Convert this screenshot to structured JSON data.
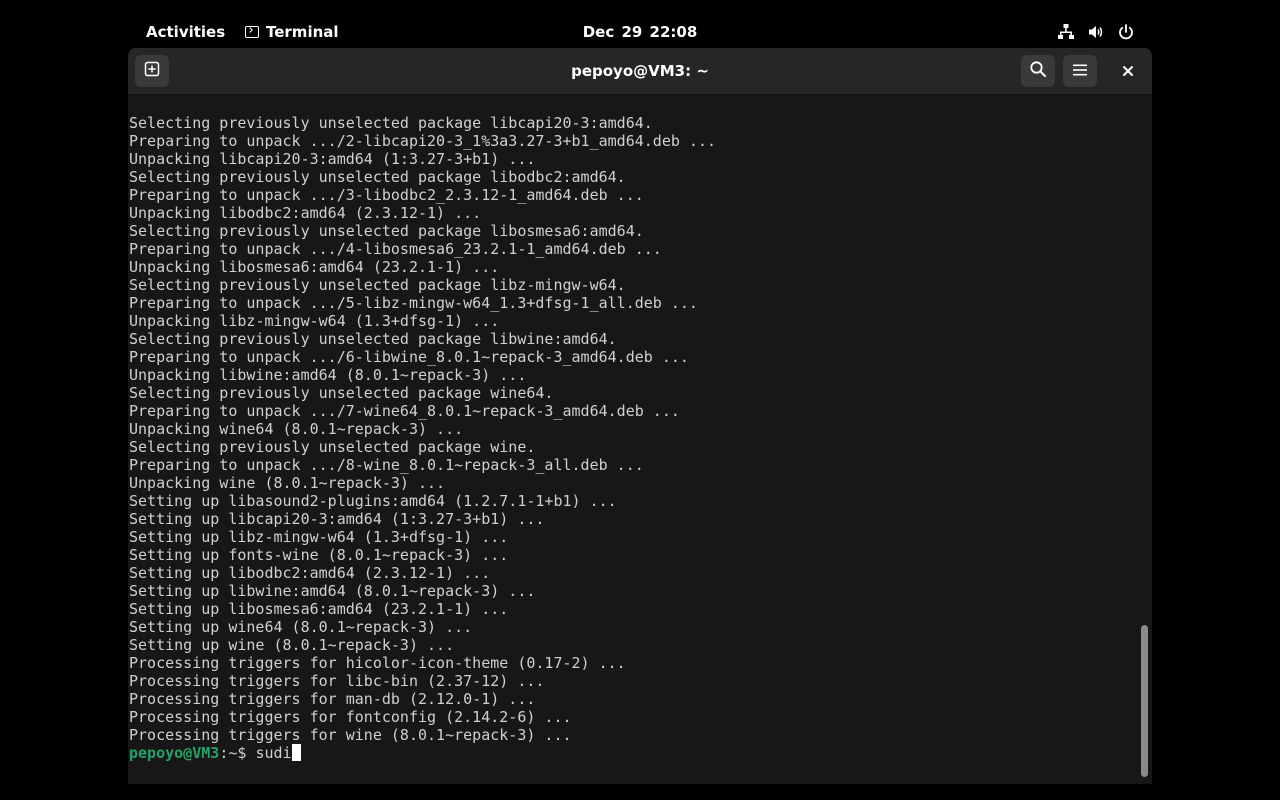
{
  "topbar": {
    "activities_label": "Activities",
    "app_name": "Terminal",
    "app_icon": "terminal-icon",
    "clock": "Dec 29  22:08",
    "tray_icons": [
      "network-icon",
      "volume-icon",
      "power-icon"
    ]
  },
  "window": {
    "title": "pepoyo@VM3: ~",
    "new_tab_icon": "new-tab-icon",
    "search_icon": "search-icon",
    "menu_icon": "hamburger-menu-icon",
    "close_icon": "close-icon"
  },
  "terminal": {
    "lines": [
      "Selecting previously unselected package libcapi20-3:amd64.",
      "Preparing to unpack .../2-libcapi20-3_1%3a3.27-3+b1_amd64.deb ...",
      "Unpacking libcapi20-3:amd64 (1:3.27-3+b1) ...",
      "Selecting previously unselected package libodbc2:amd64.",
      "Preparing to unpack .../3-libodbc2_2.3.12-1_amd64.deb ...",
      "Unpacking libodbc2:amd64 (2.3.12-1) ...",
      "Selecting previously unselected package libosmesa6:amd64.",
      "Preparing to unpack .../4-libosmesa6_23.2.1-1_amd64.deb ...",
      "Unpacking libosmesa6:amd64 (23.2.1-1) ...",
      "Selecting previously unselected package libz-mingw-w64.",
      "Preparing to unpack .../5-libz-mingw-w64_1.3+dfsg-1_all.deb ...",
      "Unpacking libz-mingw-w64 (1.3+dfsg-1) ...",
      "Selecting previously unselected package libwine:amd64.",
      "Preparing to unpack .../6-libwine_8.0.1~repack-3_amd64.deb ...",
      "Unpacking libwine:amd64 (8.0.1~repack-3) ...",
      "Selecting previously unselected package wine64.",
      "Preparing to unpack .../7-wine64_8.0.1~repack-3_amd64.deb ...",
      "Unpacking wine64 (8.0.1~repack-3) ...",
      "Selecting previously unselected package wine.",
      "Preparing to unpack .../8-wine_8.0.1~repack-3_all.deb ...",
      "Unpacking wine (8.0.1~repack-3) ...",
      "Setting up libasound2-plugins:amd64 (1.2.7.1-1+b1) ...",
      "Setting up libcapi20-3:amd64 (1:3.27-3+b1) ...",
      "Setting up libz-mingw-w64 (1.3+dfsg-1) ...",
      "Setting up fonts-wine (8.0.1~repack-3) ...",
      "Setting up libodbc2:amd64 (2.3.12-1) ...",
      "Setting up libwine:amd64 (8.0.1~repack-3) ...",
      "Setting up libosmesa6:amd64 (23.2.1-1) ...",
      "Setting up wine64 (8.0.1~repack-3) ...",
      "Setting up wine (8.0.1~repack-3) ...",
      "Processing triggers for hicolor-icon-theme (0.17-2) ...",
      "Processing triggers for libc-bin (2.37-12) ...",
      "Processing triggers for man-db (2.12.0-1) ...",
      "Processing triggers for fontconfig (2.14.2-6) ...",
      "Processing triggers for wine (8.0.1~repack-3) ..."
    ],
    "prompt_user": "pepoyo@VM3",
    "prompt_sep": ":~$ ",
    "input_text": "sudi"
  },
  "colors": {
    "prompt_green": "#26a269",
    "terminal_bg": "#171717",
    "terminal_text": "#d0d0d0",
    "headerbar_bg": "#262626"
  }
}
